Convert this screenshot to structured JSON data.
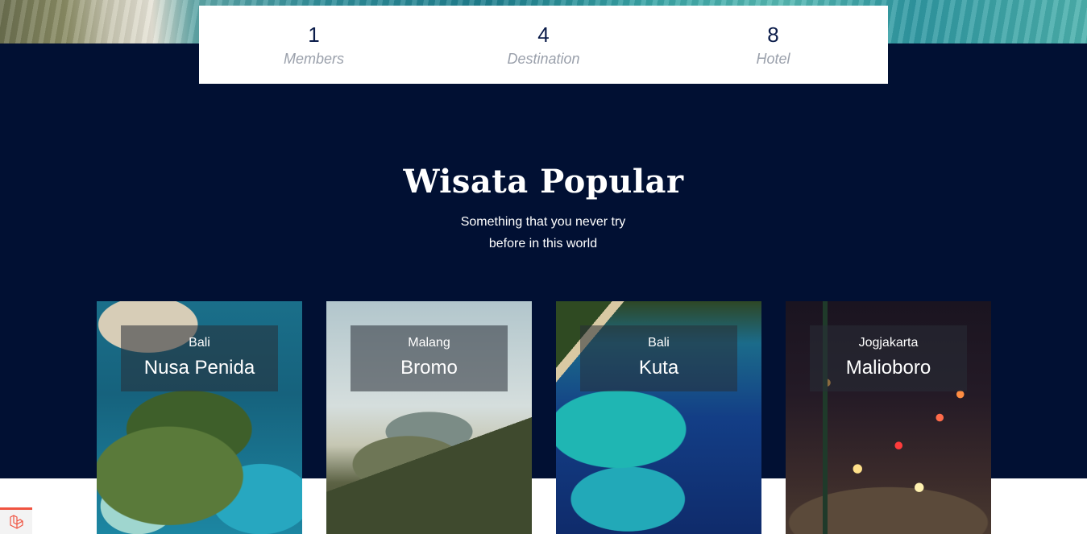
{
  "stats": [
    {
      "value": "1",
      "label": "Members"
    },
    {
      "value": "4",
      "label": "Destination"
    },
    {
      "value": "8",
      "label": "Hotel"
    }
  ],
  "section": {
    "title": "Wisata Popular",
    "subtitle_line1": "Something that you never try",
    "subtitle_line2": "before in this world"
  },
  "cards": [
    {
      "region": "Bali",
      "name": "Nusa Penida"
    },
    {
      "region": "Malang",
      "name": "Bromo"
    },
    {
      "region": "Bali",
      "name": "Kuta"
    },
    {
      "region": "Jogjakarta",
      "name": "Malioboro"
    }
  ],
  "colors": {
    "navy": "#011033",
    "stat_number": "#0b1c4a",
    "stat_label": "#9aa0ab",
    "badge_accent": "#f05340"
  },
  "icons": {
    "corner_badge": "laravel-logo-icon"
  }
}
